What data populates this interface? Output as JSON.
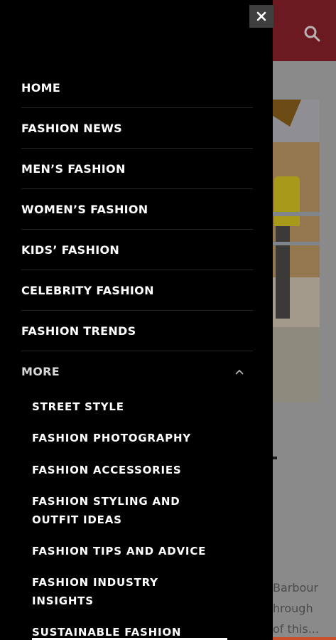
{
  "background_page": {
    "excerpt_lines": [
      "Barbour",
      "hrough",
      "of this..."
    ]
  },
  "drawer": {
    "close_icon": "close-icon",
    "menu": [
      {
        "label": "HOME"
      },
      {
        "label": "FASHION NEWS"
      },
      {
        "label": "MEN’S FASHION"
      },
      {
        "label": "WOMEN’S FASHION"
      },
      {
        "label": "KIDS’ FASHION"
      },
      {
        "label": "CELEBRITY FASHION"
      },
      {
        "label": "FASHION TRENDS"
      }
    ],
    "more": {
      "label": "MORE",
      "chevron_icon": "chevron-up-icon",
      "submenu": [
        {
          "label": "STREET STYLE"
        },
        {
          "label": "FASHION PHOTOGRAPHY"
        },
        {
          "label": "FASHION ACCESSORIES"
        },
        {
          "line1": "FASHION STYLING AND",
          "line2": "OUTFIT IDEAS"
        },
        {
          "label": "FASHION TIPS AND ADVICE"
        },
        {
          "line1": "FASHION INDUSTRY",
          "line2": "INSIGHTS"
        },
        {
          "label": "SUSTAINABLE FASHION"
        }
      ]
    }
  },
  "colors": {
    "drawer_bg": "#000000",
    "header_brand": "#8b1a2b",
    "overlay": "rgba(0,0,0,0.45)"
  }
}
